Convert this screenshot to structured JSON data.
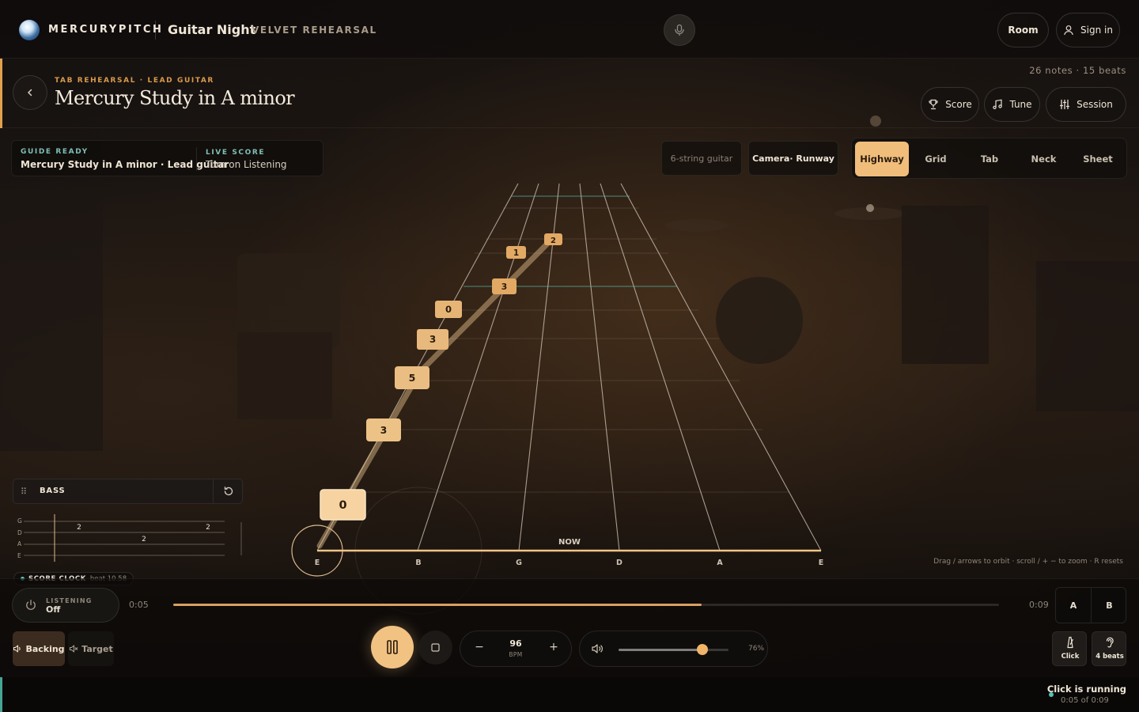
{
  "app": {
    "brand": "MERCURYPITCH",
    "event_title": "Guitar Night",
    "event_subtitle": "VELVET REHEARSAL",
    "room_label": "Room",
    "signin_label": "Sign in"
  },
  "song": {
    "kicker": "TAB REHEARSAL · LEAD GUITAR",
    "title": "Mercury Study in A minor",
    "stats": "26 notes · 15 beats",
    "actions": {
      "score": "Score",
      "tune": "Tune",
      "session": "Session"
    }
  },
  "status": {
    "guide_label": "GUIDE READY",
    "guide_value": "Mercury Study in A minor · Lead guitar",
    "live_label": "LIVE SCORE",
    "live_value": "Turn on Listening"
  },
  "instrument_label": "6-string guitar",
  "camera_label": "Camera· Runway",
  "view_tabs": [
    {
      "label": "Highway",
      "active": true
    },
    {
      "label": "Grid",
      "active": false
    },
    {
      "label": "Tab",
      "active": false
    },
    {
      "label": "Neck",
      "active": false
    },
    {
      "label": "Sheet",
      "active": false
    }
  ],
  "highway": {
    "now_label": "NOW",
    "string_labels": [
      "E",
      "B",
      "G",
      "D",
      "A",
      "E"
    ],
    "notes": [
      "2",
      "1",
      "3",
      "0",
      "3",
      "5",
      "3",
      "0"
    ],
    "hint": "Drag / arrows to orbit · scroll / + − to zoom · R resets"
  },
  "bass_panel": {
    "label": "BASS",
    "string_labels": [
      "G",
      "D",
      "A",
      "E"
    ],
    "notes": [
      "2",
      "2",
      "2"
    ]
  },
  "score_clock": {
    "label": "SCORE CLOCK",
    "beat": "beat 10.58"
  },
  "transport": {
    "listening_label": "LISTENING",
    "listening_value": "Off",
    "time_current": "0:05",
    "time_total": "0:09",
    "progress": 0.64,
    "loop_a": "A",
    "loop_b": "B",
    "backing_label": "Backing",
    "target_label": "Target",
    "bpm_value": "96",
    "bpm_unit": "BPM",
    "bpm_minus": "−",
    "bpm_plus": "+",
    "volume": 0.76,
    "volume_label": "76%",
    "click_label": "Click",
    "beats_label": "4 beats"
  },
  "footer_status": {
    "title": "Click is running",
    "subtitle": "0:05 of 0:09"
  },
  "colors": {
    "accent": "#f1bd7b",
    "accent_dark": "#d9a060",
    "teal": "#63c5b6"
  }
}
